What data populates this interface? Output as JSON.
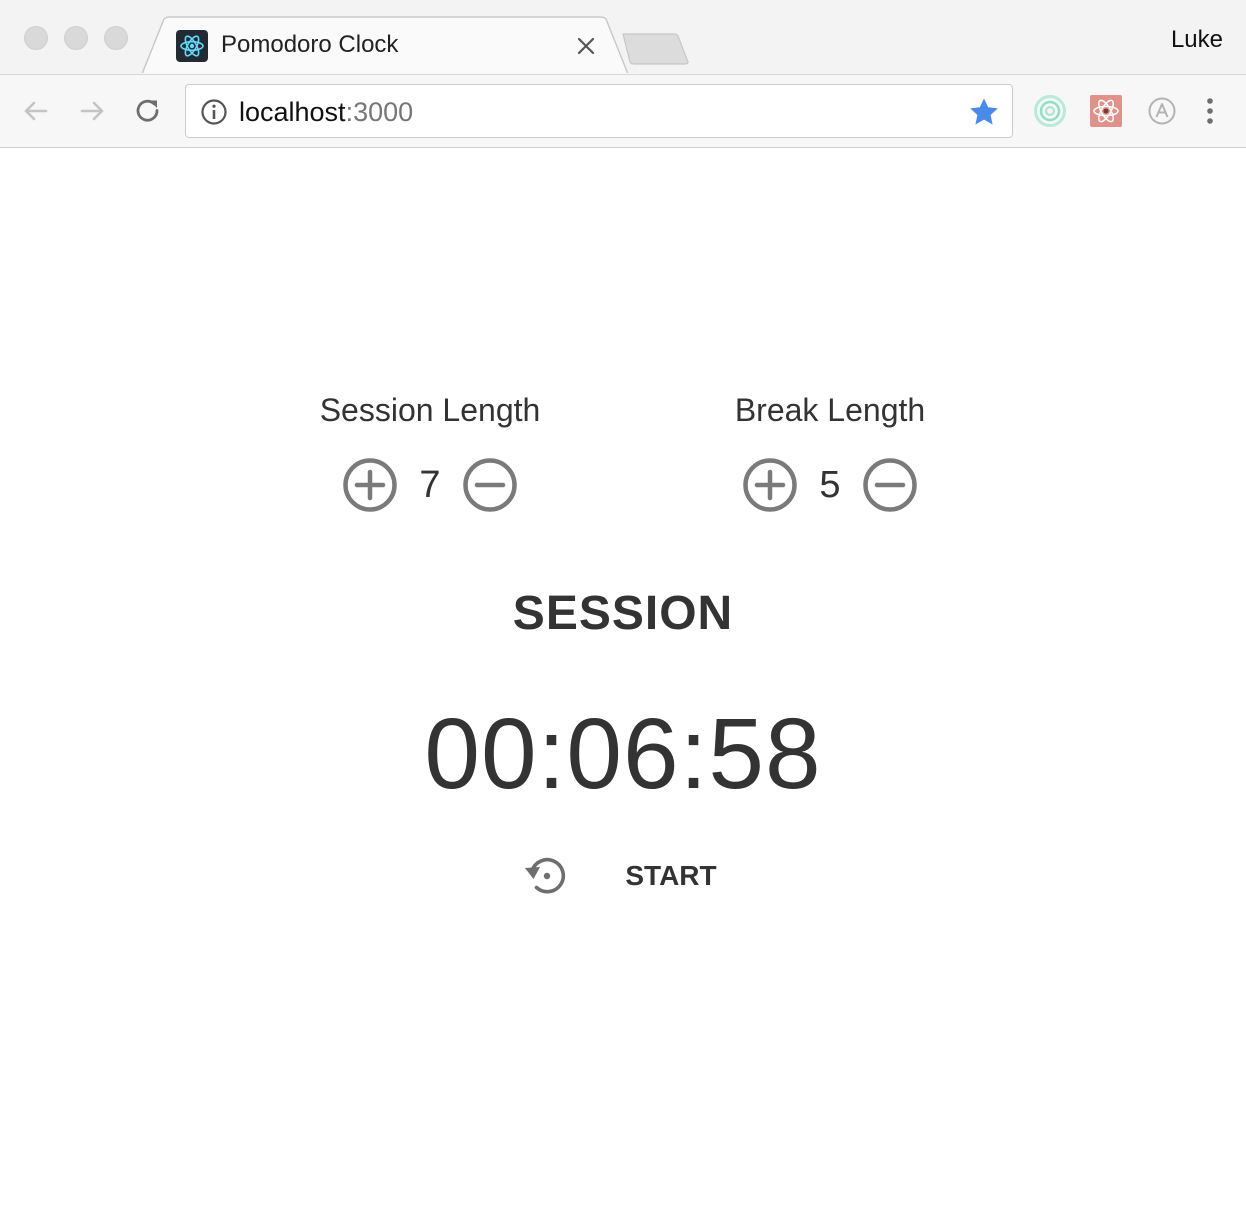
{
  "browser": {
    "tab_title": "Pomodoro Clock",
    "profile_name": "Luke",
    "url_host": "localhost",
    "url_port": ":3000",
    "icons": [
      "back-arrow-icon",
      "forward-arrow-icon",
      "reload-icon",
      "info-icon",
      "bookmark-star-icon",
      "extension-icon",
      "react-devtools-icon",
      "a-circle-icon",
      "kebab-menu-icon",
      "react-logo-icon",
      "close-icon"
    ]
  },
  "colors": {
    "button_gray": "#7a7a7a",
    "text_dark": "#333333",
    "star_blue": "#4a8ae8",
    "favicon_bg": "#222a33",
    "react_cyan": "#61dafb"
  },
  "app": {
    "session": {
      "label": "Session Length",
      "value": "7"
    },
    "break": {
      "label": "Break Length",
      "value": "5"
    },
    "status": "SESSION",
    "timer": "00:06:58",
    "start_label": "START"
  }
}
